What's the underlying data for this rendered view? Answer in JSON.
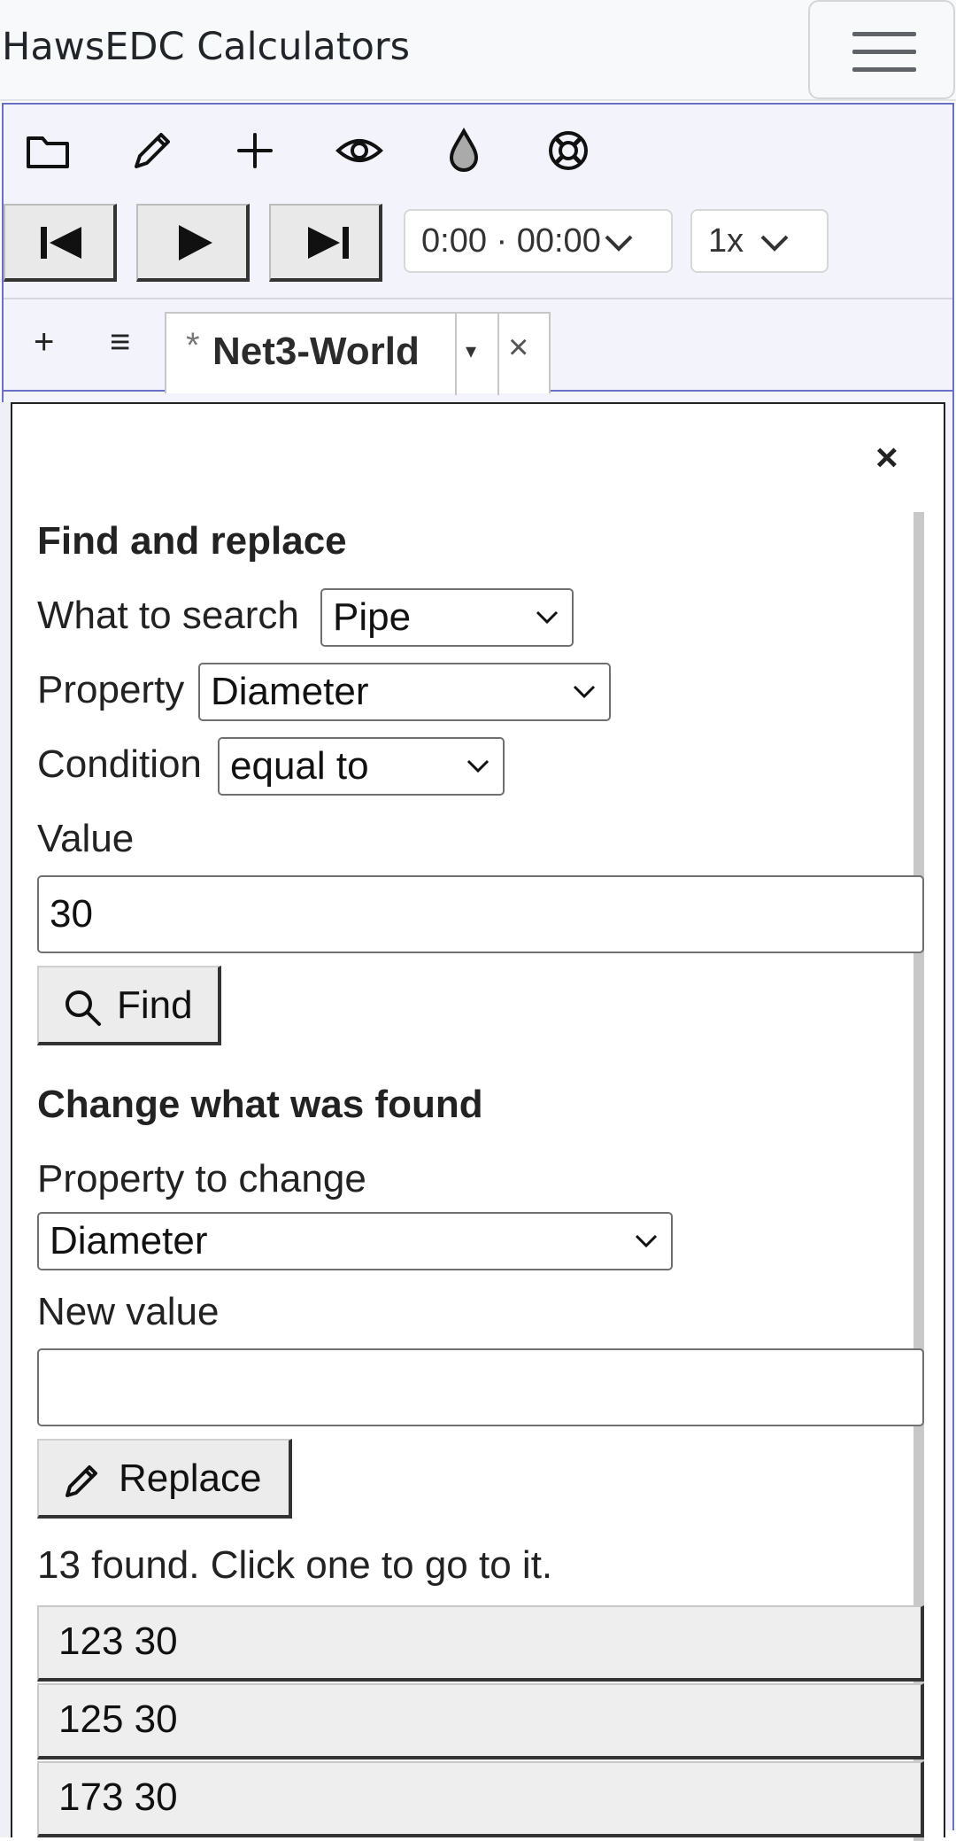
{
  "header": {
    "title": "HawsEDC Calculators",
    "menu_icon": "hamburger-menu-icon"
  },
  "toolbar": {
    "icons": [
      "folder-icon",
      "pencil-icon",
      "plus-icon",
      "eye-icon",
      "droplet-icon",
      "lifebuoy-icon"
    ],
    "media_buttons": [
      "skip-to-start-icon",
      "play-icon",
      "skip-to-end-icon"
    ],
    "time_select": "0:00 · 00:00",
    "speed_select": "1x"
  },
  "tabs": {
    "add": "+",
    "list": "≡",
    "active_tab": {
      "modified_marker": "*",
      "title": "Net3-World",
      "dropdown": "▾",
      "close": "×"
    }
  },
  "find_replace": {
    "close": "×",
    "heading": "Find and replace",
    "what_label": "What to search",
    "what_value": "Pipe",
    "property_label": "Property",
    "property_value": "Diameter",
    "condition_label": "Condition",
    "condition_value": "equal to",
    "value_label": "Value",
    "value_value": "30",
    "find_button": "Find",
    "change_heading": "Change what was found",
    "change_property_label": "Property to change",
    "change_property_value": "Diameter",
    "new_value_label": "New value",
    "new_value_value": "",
    "replace_button": "Replace",
    "results_summary": "13 found. Click one to go to it.",
    "results": [
      "123 30",
      "125 30",
      "173 30"
    ]
  }
}
